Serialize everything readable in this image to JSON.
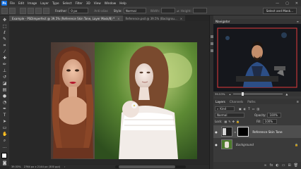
{
  "menubar": {
    "logo": "Ps",
    "items": [
      "File",
      "Edit",
      "Image",
      "Layer",
      "Type",
      "Select",
      "Filter",
      "3D",
      "View",
      "Window",
      "Help"
    ],
    "window_controls": [
      "—",
      "▢",
      "✕"
    ]
  },
  "options": {
    "feather_label": "Feather:",
    "feather_value": "0 px",
    "antialias_label": "Anti-alias",
    "style_label": "Style:",
    "style_value": "Normal",
    "width_label": "Width:",
    "height_label": "Height:",
    "select_mask_label": "Select and Mask..."
  },
  "tabs": [
    {
      "label": "Example - PSDimperfect @ 39.5% (Reference Skin Tone, Layer Mask/8) *",
      "close": "×"
    },
    {
      "label": "Reference.psd @ 39.5% (Backgrou...",
      "close": "×"
    }
  ],
  "status": {
    "zoom": "39.53%",
    "doc": "2764 px x 2144 px (300 ppi)"
  },
  "navigator": {
    "title": "Navigator",
    "zoom": "39.53%"
  },
  "layers_panel": {
    "tabs": [
      "Layers",
      "Channels",
      "Paths"
    ],
    "kind_label": "Kind",
    "blend_mode": "Normal",
    "opacity_label": "Opacity:",
    "opacity_value": "100%",
    "lock_label": "Lock:",
    "fill_label": "Fill:",
    "fill_value": "100%",
    "layers": [
      {
        "name": "Reference Skin Tone",
        "visible_glyph": "●",
        "selected": true
      },
      {
        "name": "Background",
        "visible_glyph": "●",
        "selected": false
      }
    ],
    "bottom_icons": [
      "fx",
      "◐",
      "▭",
      "⊞",
      "🗑"
    ]
  },
  "icons": [
    "move-icon",
    "marquee-icon",
    "lasso-icon",
    "quick-select-icon",
    "crop-icon",
    "eyedropper-icon",
    "healing-icon",
    "brush-icon",
    "stamp-icon",
    "history-brush-icon",
    "eraser-icon",
    "gradient-icon",
    "blur-icon",
    "dodge-icon",
    "pen-icon",
    "type-icon",
    "path-select-icon",
    "shape-icon",
    "hand-icon",
    "zoom-icon"
  ]
}
